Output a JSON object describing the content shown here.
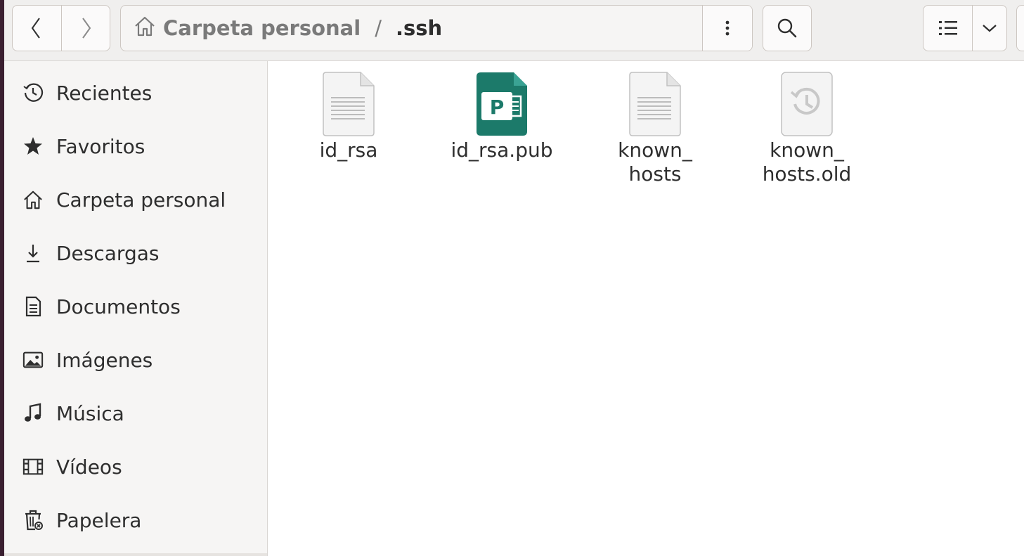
{
  "header": {
    "path": {
      "home_label": "Carpeta personal",
      "separator": "/",
      "current": ".ssh"
    }
  },
  "sidebar": {
    "items": [
      {
        "label": "Recientes",
        "icon": "clock-icon"
      },
      {
        "label": "Favoritos",
        "icon": "star-icon"
      },
      {
        "label": "Carpeta personal",
        "icon": "home-icon"
      },
      {
        "label": "Descargas",
        "icon": "download-icon"
      },
      {
        "label": "Documentos",
        "icon": "document-icon"
      },
      {
        "label": "Imágenes",
        "icon": "image-icon"
      },
      {
        "label": "Música",
        "icon": "music-icon"
      },
      {
        "label": "Vídeos",
        "icon": "film-icon"
      },
      {
        "label": "Papelera",
        "icon": "trash-icon"
      }
    ]
  },
  "files": [
    {
      "line1": "id_rsa",
      "line2": "",
      "icon": "text-file-icon"
    },
    {
      "line1": "id_rsa.pub",
      "line2": "",
      "icon": "publisher-file-icon"
    },
    {
      "line1": "known_",
      "line2": "hosts",
      "icon": "text-file-icon"
    },
    {
      "line1": "known_",
      "line2": "hosts.old",
      "icon": "backup-file-icon"
    }
  ],
  "colors": {
    "publisher_green": "#1c7a6a",
    "header_bg": "#f0efee",
    "sidebar_bg": "#f6f5f4"
  }
}
